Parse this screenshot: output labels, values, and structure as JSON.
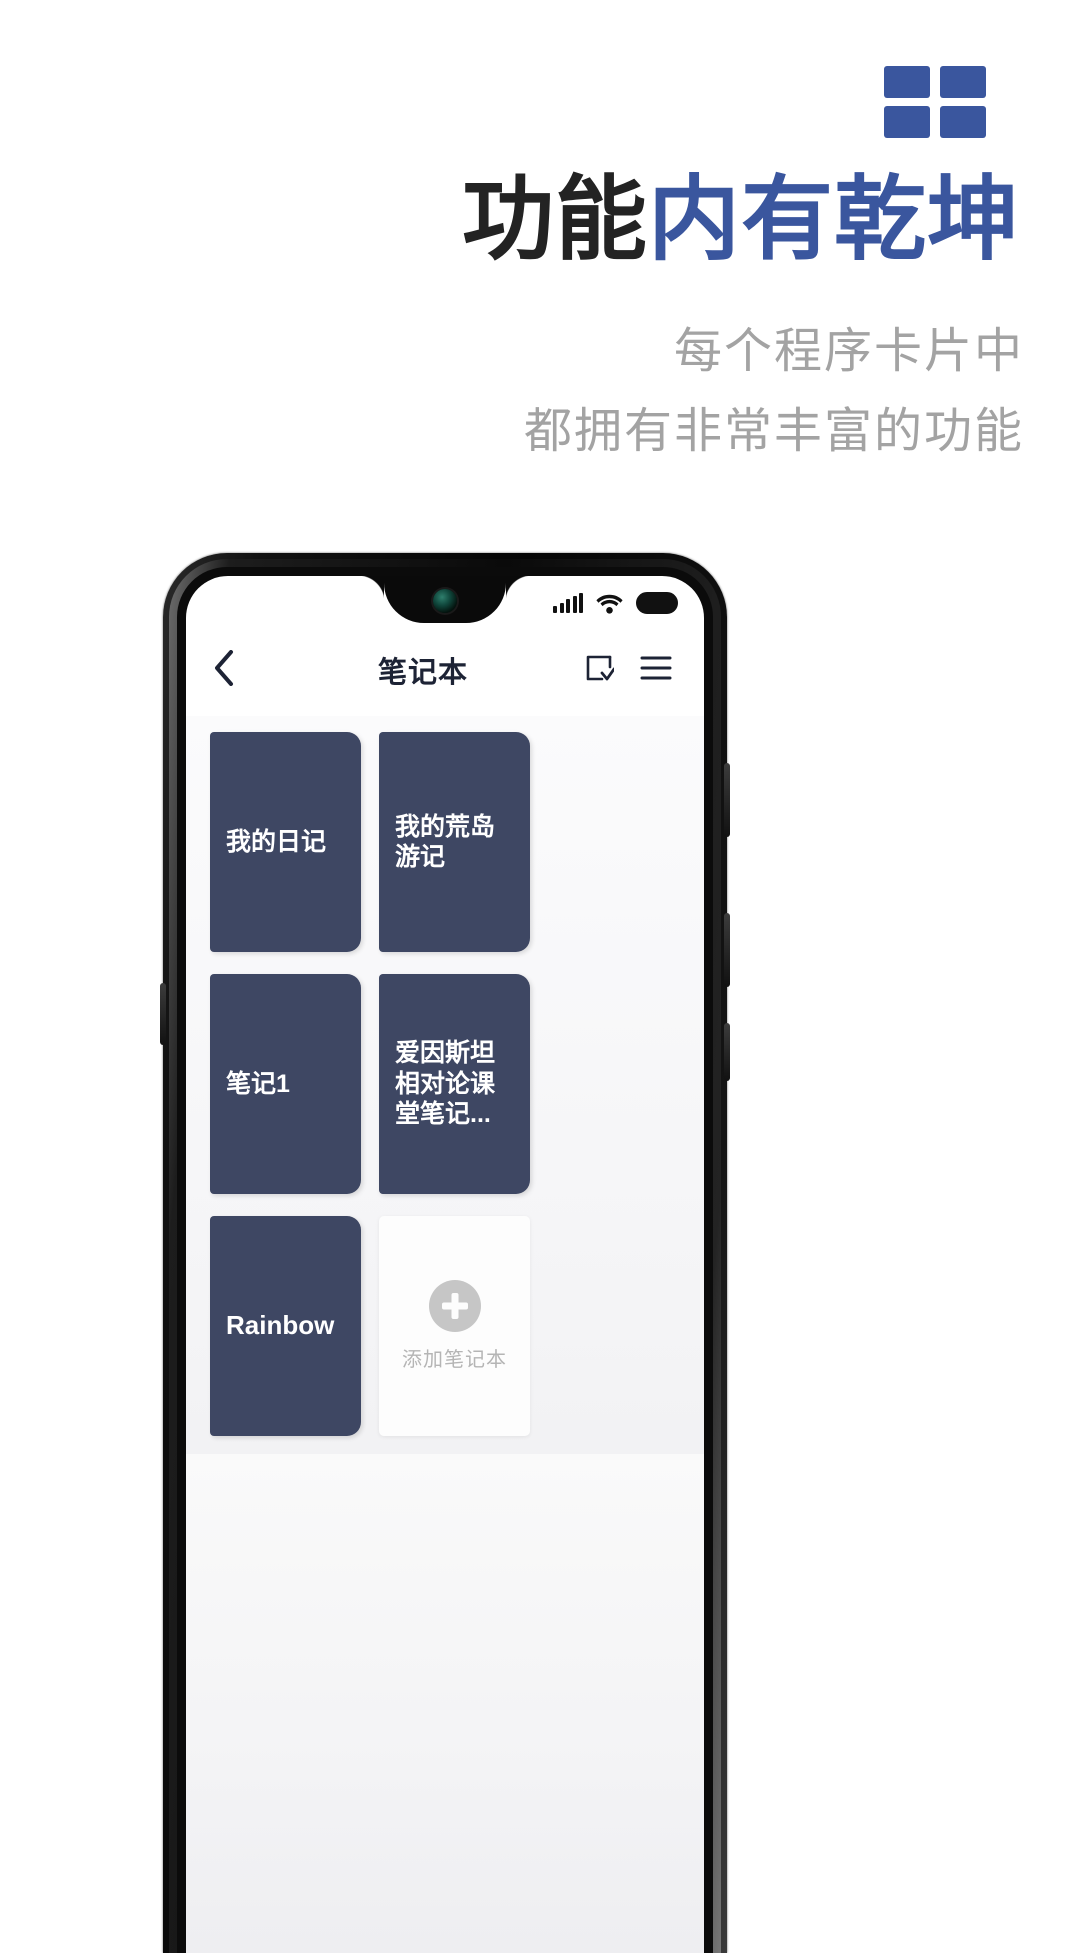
{
  "brand": {
    "logo_icon": "grid-2x2-icon",
    "logo_color": "#3a569e",
    "tiles": 4
  },
  "headline": {
    "part_dark": "功能",
    "part_accent": "内有乾坤"
  },
  "subtitle": {
    "line1": "每个程序卡片中",
    "line2": "都拥有非常丰富的功能",
    "color": "#a3a3a3"
  },
  "phone": {
    "status_bar": {
      "signal_icon": "signal-bars-icon",
      "signal_bars": 5,
      "wifi_icon": "wifi-icon",
      "battery_icon": "battery-full-icon"
    },
    "app_header": {
      "back_icon": "chevron-left-icon",
      "title": "笔记本",
      "select_icon": "select-check-icon",
      "menu_icon": "hamburger-menu-icon"
    },
    "notebooks": [
      {
        "title": "我的日记",
        "latin": false
      },
      {
        "title": "我的荒岛游记",
        "latin": false
      },
      {
        "title": "笔记1",
        "latin": false
      },
      {
        "title": "爱因斯坦相对论课堂笔记...",
        "latin": false
      },
      {
        "title": "Rainbow",
        "latin": true
      }
    ],
    "add_card": {
      "icon": "plus-circle-icon",
      "label": "添加笔记本"
    },
    "card_color": "#3e4763"
  }
}
